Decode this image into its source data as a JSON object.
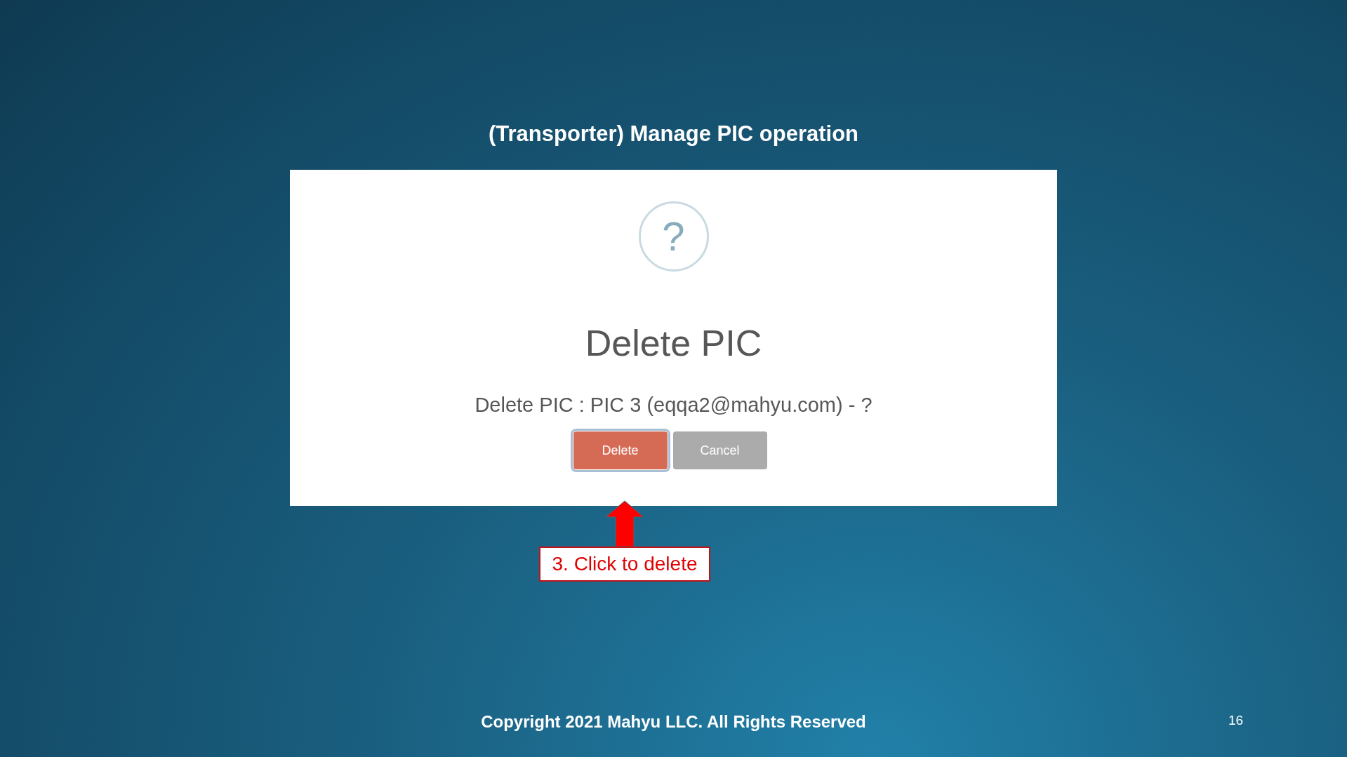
{
  "slide_title": "(Transporter) Manage PIC operation",
  "dialog": {
    "icon": "?",
    "heading": "Delete PIC",
    "message": "Delete PIC : PIC 3 (eqqa2@mahyu.com) - ?",
    "buttons": [
      {
        "label": "Delete",
        "kind": "confirm",
        "focused": true
      },
      {
        "label": "Cancel",
        "kind": "cancel",
        "focused": false
      }
    ]
  },
  "callout": "3. Click to delete",
  "footer": "Copyright 2021 Mahyu LLC. All Rights Reserved",
  "page_number": "16"
}
